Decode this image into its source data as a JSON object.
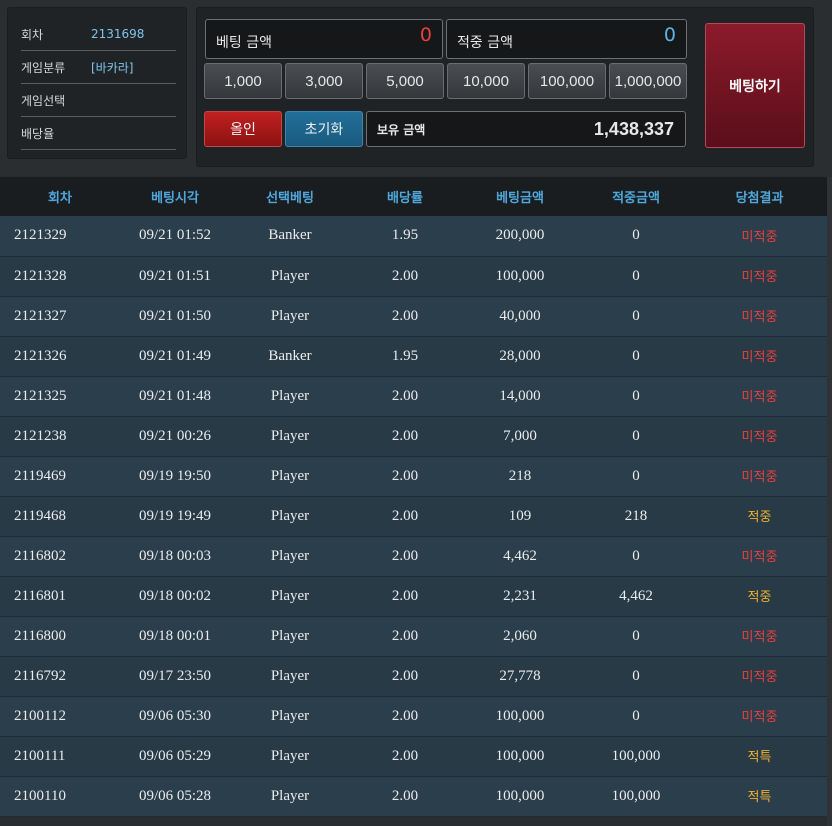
{
  "info": {
    "round_label": "회차",
    "round_value": "2131698",
    "category_label": "게임분류",
    "category_value": "[바카라]",
    "select_label": "게임선택",
    "select_value": "",
    "odds_label": "배당율",
    "odds_value": ""
  },
  "bet_panel": {
    "bet_amount_label": "베팅 금액",
    "bet_amount_value": "0",
    "win_amount_label": "적중 금액",
    "win_amount_value": "0",
    "chips": [
      "1,000",
      "3,000",
      "5,000",
      "10,000",
      "100,000",
      "1,000,000"
    ],
    "allin_label": "올인",
    "reset_label": "초기화",
    "holding_label": "보유 금액",
    "holding_value": "1,438,337",
    "bet_button_label": "베팅하기"
  },
  "colors": {
    "lose": "#e8403d",
    "win": "#f0b030",
    "header_text": "#4fa8dc"
  },
  "table": {
    "headers": [
      "회차",
      "베팅시각",
      "선택베팅",
      "배당률",
      "베팅금액",
      "적중금액",
      "당첨결과"
    ],
    "rows": [
      {
        "round": "2121329",
        "time": "09/21 01:52",
        "pick": "Banker",
        "odds": "1.95",
        "bet": "200,000",
        "win": "0",
        "result": "미적중",
        "status": "lose"
      },
      {
        "round": "2121328",
        "time": "09/21 01:51",
        "pick": "Player",
        "odds": "2.00",
        "bet": "100,000",
        "win": "0",
        "result": "미적중",
        "status": "lose"
      },
      {
        "round": "2121327",
        "time": "09/21 01:50",
        "pick": "Player",
        "odds": "2.00",
        "bet": "40,000",
        "win": "0",
        "result": "미적중",
        "status": "lose"
      },
      {
        "round": "2121326",
        "time": "09/21 01:49",
        "pick": "Banker",
        "odds": "1.95",
        "bet": "28,000",
        "win": "0",
        "result": "미적중",
        "status": "lose"
      },
      {
        "round": "2121325",
        "time": "09/21 01:48",
        "pick": "Player",
        "odds": "2.00",
        "bet": "14,000",
        "win": "0",
        "result": "미적중",
        "status": "lose"
      },
      {
        "round": "2121238",
        "time": "09/21 00:26",
        "pick": "Player",
        "odds": "2.00",
        "bet": "7,000",
        "win": "0",
        "result": "미적중",
        "status": "lose"
      },
      {
        "round": "2119469",
        "time": "09/19 19:50",
        "pick": "Player",
        "odds": "2.00",
        "bet": "218",
        "win": "0",
        "result": "미적중",
        "status": "lose"
      },
      {
        "round": "2119468",
        "time": "09/19 19:49",
        "pick": "Player",
        "odds": "2.00",
        "bet": "109",
        "win": "218",
        "result": "적중",
        "status": "win"
      },
      {
        "round": "2116802",
        "time": "09/18 00:03",
        "pick": "Player",
        "odds": "2.00",
        "bet": "4,462",
        "win": "0",
        "result": "미적중",
        "status": "lose"
      },
      {
        "round": "2116801",
        "time": "09/18 00:02",
        "pick": "Player",
        "odds": "2.00",
        "bet": "2,231",
        "win": "4,462",
        "result": "적중",
        "status": "win"
      },
      {
        "round": "2116800",
        "time": "09/18 00:01",
        "pick": "Player",
        "odds": "2.00",
        "bet": "2,060",
        "win": "0",
        "result": "미적중",
        "status": "lose"
      },
      {
        "round": "2116792",
        "time": "09/17 23:50",
        "pick": "Player",
        "odds": "2.00",
        "bet": "27,778",
        "win": "0",
        "result": "미적중",
        "status": "lose"
      },
      {
        "round": "2100112",
        "time": "09/06 05:30",
        "pick": "Player",
        "odds": "2.00",
        "bet": "100,000",
        "win": "0",
        "result": "미적중",
        "status": "lose"
      },
      {
        "round": "2100111",
        "time": "09/06 05:29",
        "pick": "Player",
        "odds": "2.00",
        "bet": "100,000",
        "win": "100,000",
        "result": "적특",
        "status": "win"
      },
      {
        "round": "2100110",
        "time": "09/06 05:28",
        "pick": "Player",
        "odds": "2.00",
        "bet": "100,000",
        "win": "100,000",
        "result": "적특",
        "status": "win"
      }
    ]
  }
}
